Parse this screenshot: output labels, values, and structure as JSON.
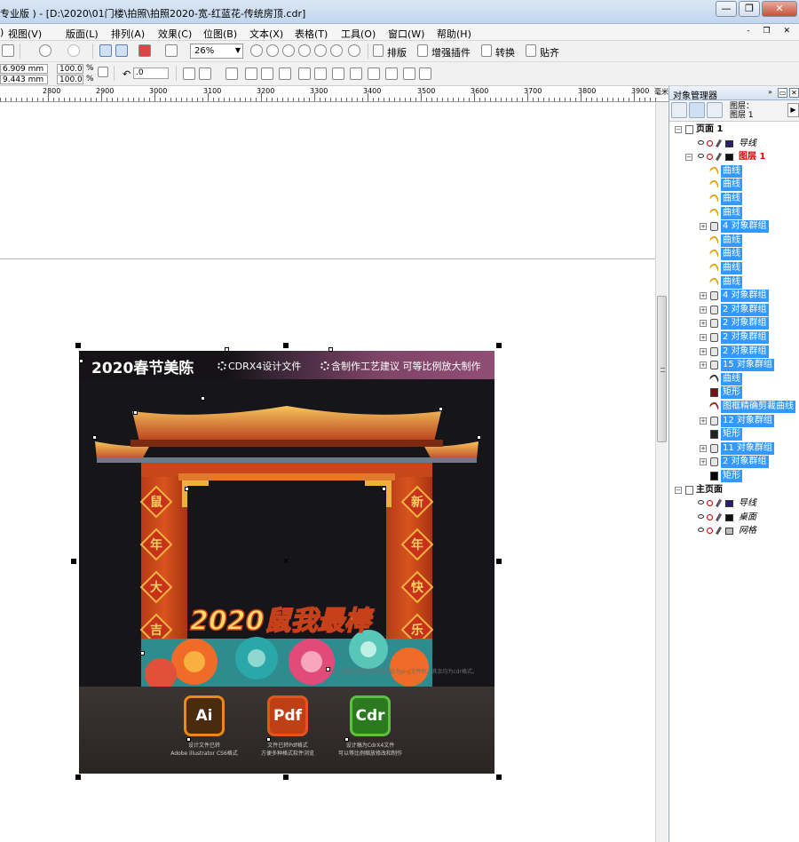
{
  "window": {
    "title": "专业版 ) - [D:\\2020\\01门楼\\拍照\\拍照2020-宽-红蓝花-传统房顶.cdr]",
    "controls": {
      "minimize": "—",
      "restore": "❐",
      "close": "✕"
    }
  },
  "menu": {
    "items": [
      "视图(V)",
      "版面(L)",
      "排列(A)",
      "效果(C)",
      "位图(B)",
      "文本(X)",
      "表格(T)",
      "工具(O)",
      "窗口(W)",
      "帮助(H)"
    ],
    "first_partial": ")",
    "mdi_controls": [
      "-",
      "❐",
      "✕"
    ]
  },
  "toolbar": {
    "zoom_value": "26%",
    "buttons": {
      "layout": "排版",
      "enhance": "增强插件",
      "convert": "转换",
      "paste_align": "贴齐"
    }
  },
  "propbar": {
    "x": "6.909 mm",
    "y": "9.443 mm",
    "scale_w": "100.0",
    "scale_h": "100.0",
    "pct_w": "%",
    "pct_h": "%",
    "rotation": ".0"
  },
  "ruler": {
    "ticks": [
      "2800",
      "2900",
      "3000",
      "3100",
      "3200",
      "3300",
      "3400",
      "3500",
      "3600",
      "3700",
      "3800",
      "3900"
    ],
    "unit": "毫米"
  },
  "artwork": {
    "banner_title": "2020春节美陈",
    "banner_file": "CDRX4设计文件",
    "banner_note": "含制作工艺建议 可等比例放大制作",
    "couplet_left": [
      "鼠",
      "年",
      "大",
      "吉"
    ],
    "couplet_right": [
      "新",
      "年",
      "快",
      "乐"
    ],
    "slogan": "2020鼠我最棒",
    "bottom_note": "注：放在右侧边的新年福娃为png文件所，其余均为cdr格式。",
    "formats": [
      {
        "label": "Ai",
        "caption1": "设计文件已转",
        "caption2": "Adobe illustrator CS6格式"
      },
      {
        "label": "Pdf",
        "caption1": "文件已转Pdf格式",
        "caption2": "方便多种格式软件浏览"
      },
      {
        "label": "Cdr",
        "caption1": "设计稿为CdrX4文件",
        "caption2": "可以等比例缩放修改和制作"
      }
    ]
  },
  "panel": {
    "title": "对象管理器",
    "layer_label": "图层：",
    "layer_value": "图层 1",
    "tree": [
      {
        "indent": 0,
        "expander": "⊟",
        "label": "页面 1",
        "style": "bold"
      },
      {
        "indent": 1,
        "label": "导线",
        "style": "ital",
        "swatch": "#2b1d6b"
      },
      {
        "indent": 1,
        "expander": "⊟",
        "label": "图层 1",
        "style": "red",
        "swatch": "#111111"
      },
      {
        "indent": 2,
        "label": "曲线",
        "style": "sel",
        "type": "curve"
      },
      {
        "indent": 2,
        "label": "曲线",
        "style": "sel",
        "type": "curve"
      },
      {
        "indent": 2,
        "label": "曲线",
        "style": "sel",
        "type": "curve"
      },
      {
        "indent": 2,
        "label": "曲线",
        "style": "sel",
        "type": "curve"
      },
      {
        "indent": 2,
        "expander": "⊞",
        "label": "4 对象群组",
        "style": "sel",
        "type": "group"
      },
      {
        "indent": 2,
        "label": "曲线",
        "style": "sel",
        "type": "curve"
      },
      {
        "indent": 2,
        "label": "曲线",
        "style": "sel",
        "type": "curve"
      },
      {
        "indent": 2,
        "label": "曲线",
        "style": "sel",
        "type": "curve"
      },
      {
        "indent": 2,
        "label": "曲线",
        "style": "sel",
        "type": "curve"
      },
      {
        "indent": 2,
        "expander": "⊞",
        "label": "4 对象群组",
        "style": "sel",
        "type": "group"
      },
      {
        "indent": 2,
        "expander": "⊞",
        "label": "2 对象群组",
        "style": "sel",
        "type": "group"
      },
      {
        "indent": 2,
        "expander": "⊞",
        "label": "2 对象群组",
        "style": "sel",
        "type": "group"
      },
      {
        "indent": 2,
        "expander": "⊞",
        "label": "2 对象群组",
        "style": "sel",
        "type": "group"
      },
      {
        "indent": 2,
        "expander": "⊞",
        "label": "2 对象群组",
        "style": "sel",
        "type": "group"
      },
      {
        "indent": 2,
        "expander": "⊞",
        "label": "15 对象群组",
        "style": "sel",
        "type": "group"
      },
      {
        "indent": 2,
        "label": "曲线",
        "style": "sel",
        "type": "curve-dark"
      },
      {
        "indent": 2,
        "label": "矩形",
        "style": "sel",
        "type": "rect-red"
      },
      {
        "indent": 2,
        "label": "图框精确剪裁曲线",
        "style": "sel",
        "type": "clip"
      },
      {
        "indent": 2,
        "expander": "⊞",
        "label": "12 对象群组",
        "style": "sel",
        "type": "group"
      },
      {
        "indent": 2,
        "label": "矩形",
        "style": "sel",
        "type": "rect-dark"
      },
      {
        "indent": 2,
        "expander": "⊞",
        "label": "11 对象群组",
        "style": "sel",
        "type": "group"
      },
      {
        "indent": 2,
        "expander": "⊞",
        "label": "2 对象群组",
        "style": "sel",
        "type": "group"
      },
      {
        "indent": 2,
        "label": "矩形",
        "style": "sel",
        "type": "rect-black"
      },
      {
        "indent": 0,
        "expander": "⊟",
        "label": "主页面",
        "style": "bold"
      },
      {
        "indent": 1,
        "label": "导线",
        "style": "ital",
        "swatch": "#2b1d6b"
      },
      {
        "indent": 1,
        "label": "桌面",
        "style": "ital",
        "swatch": "#111111"
      },
      {
        "indent": 1,
        "label": "网格",
        "style": "ital",
        "swatch": "#bfbfbf"
      }
    ]
  },
  "colors": {
    "selection": "#3399ff",
    "accent_red": "#e00000"
  }
}
